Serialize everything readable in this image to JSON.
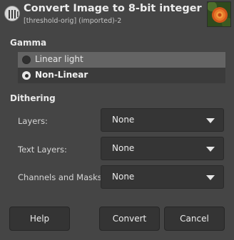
{
  "dialog": {
    "title": "Convert Image to 8-bit integer",
    "subtitle": "[threshold-orig] (imported)-2"
  },
  "gamma": {
    "label": "Gamma",
    "options": [
      {
        "label": "Linear light",
        "selected": false
      },
      {
        "label": "Non-Linear",
        "selected": true
      }
    ]
  },
  "dithering": {
    "label": "Dithering",
    "layers": {
      "label": "Layers:",
      "value": "None"
    },
    "text_layers": {
      "label": "Text Layers:",
      "value": "None"
    },
    "channels": {
      "label": "Channels and Masks:",
      "value": "None"
    }
  },
  "buttons": {
    "help": "Help",
    "convert": "Convert",
    "cancel": "Cancel"
  },
  "icons": {
    "app": "gimp-convert-icon",
    "thumbnail": "image-thumbnail",
    "dropdown": "chevron-down-icon"
  },
  "colors": {
    "background": "#454545",
    "selected_row": "#646464",
    "combo_bg": "#353535"
  }
}
